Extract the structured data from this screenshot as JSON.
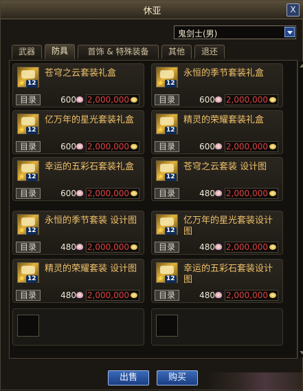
{
  "window": {
    "title": "休亚",
    "close_label": "X"
  },
  "job_select": {
    "value": "鬼剑士(男)"
  },
  "tabs": [
    {
      "label": "武器"
    },
    {
      "label": "防具"
    },
    {
      "label": "首饰 & 特殊装备"
    },
    {
      "label": "其他"
    },
    {
      "label": "退还"
    }
  ],
  "active_tab": "防具",
  "items": [
    {
      "name": "苍穹之云套装礼盒",
      "catalog_label": "目录",
      "count": "600",
      "price": "2,000,000"
    },
    {
      "name": "永恒的季节套装礼盒",
      "catalog_label": "目录",
      "count": "600",
      "price": "2,000,000"
    },
    {
      "name": "亿万年的星光套装礼盒",
      "catalog_label": "目录",
      "count": "600",
      "price": "2,000,000"
    },
    {
      "name": "精灵的荣耀套装礼盒",
      "catalog_label": "目录",
      "count": "600",
      "price": "2,000,000"
    },
    {
      "name": "幸运的五彩石套装礼盒",
      "catalog_label": "目录",
      "count": "600",
      "price": "2,000,000"
    },
    {
      "name": "苍穹之云套装 设计图",
      "catalog_label": "目录",
      "count": "480",
      "price": "2,000,000"
    },
    {
      "name": "永恒的季节套装 设计图",
      "catalog_label": "目录",
      "count": "480",
      "price": "2,000,000"
    },
    {
      "name": "亿万年的星光套装设计图",
      "catalog_label": "目录",
      "count": "480",
      "price": "2,000,000"
    },
    {
      "name": "精灵的荣耀套装 设计图",
      "catalog_label": "目录",
      "count": "480",
      "price": "2,000,000"
    },
    {
      "name": "幸运的五彩石套装设计图",
      "catalog_label": "目录",
      "count": "480",
      "price": "2,000,000"
    }
  ],
  "icons": {
    "close": "close-icon",
    "dropdown": "chevron-down-icon",
    "count": "material-icon",
    "gold": "gold-coin-icon"
  },
  "buttons": {
    "sell": "出售",
    "buy": "购买"
  },
  "colors": {
    "price": "#e04040",
    "item_name": "#eec06a",
    "button": "#2a55a0"
  }
}
